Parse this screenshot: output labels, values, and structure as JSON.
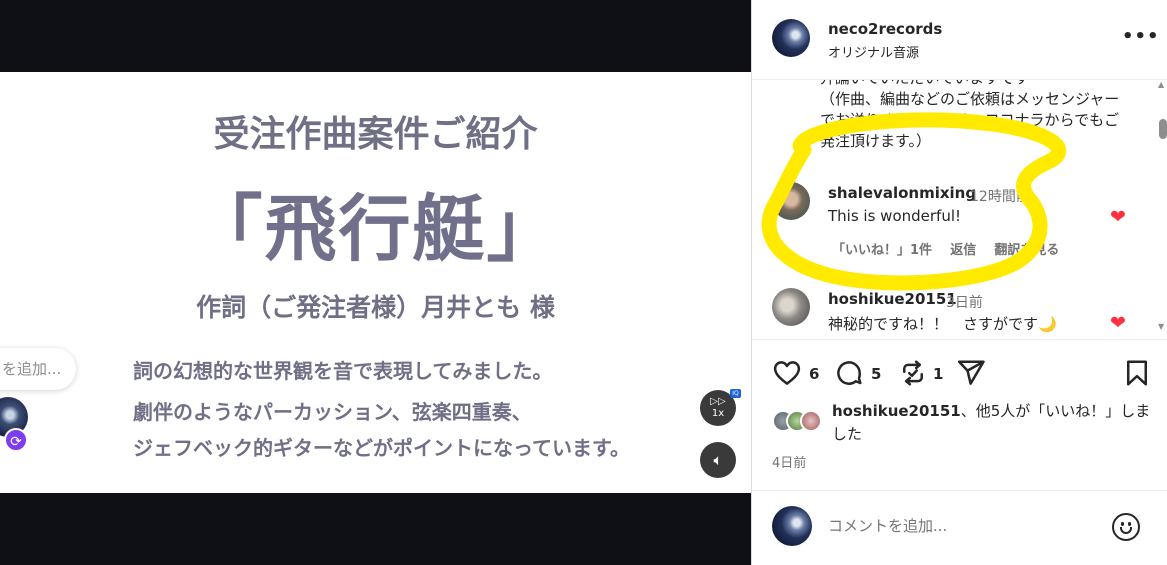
{
  "slide": {
    "heading": "受注作曲案件ご紹介",
    "title": "「飛行艇」",
    "credit": "作詞（ご発注者様）月井とも 様",
    "body": [
      "詞の幻想的な世界観を音で表現してみました。",
      "劇伴のようなパーカッション、弦楽四重奏、",
      "ジェフベック的ギターなどがポイントになっています。"
    ]
  },
  "media_controls": {
    "speed_label": "1x",
    "speed_badge": "IQ",
    "overlay_comment_partial": "を追加..."
  },
  "header": {
    "username": "neco2records",
    "audio": "オリジナル音源",
    "more": "•••"
  },
  "caption": {
    "partial_line": "弁論いていただいていますです",
    "text": "（作曲、編曲などのご依頼はメッセンジャーでお送りくださいませ。ココナラからでもご発注頂けます。）"
  },
  "comments": [
    {
      "username": "shalevalonmixing",
      "time": "12時間前",
      "text": "This is wonderful!",
      "likes": "「いいね！」1件",
      "reply": "返信",
      "translate": "翻訳を見る",
      "liked": true
    },
    {
      "username": "hoshikue20151",
      "time": "3日前",
      "text": "神秘的ですね！！　さすがです🌙",
      "liked": true
    }
  ],
  "actions": {
    "likes_count": "6",
    "comments_count": "5",
    "reposts_count": "1"
  },
  "likes_summary": {
    "user": "hoshikue20151",
    "rest": "、他5人が「いいね！」しました"
  },
  "post_date": "4日前",
  "add_comment": {
    "placeholder": "コメントを追加..."
  },
  "colors": {
    "heart": "#ff3040",
    "highlight": "#ffea00",
    "slide_text": "#6f6f86"
  }
}
